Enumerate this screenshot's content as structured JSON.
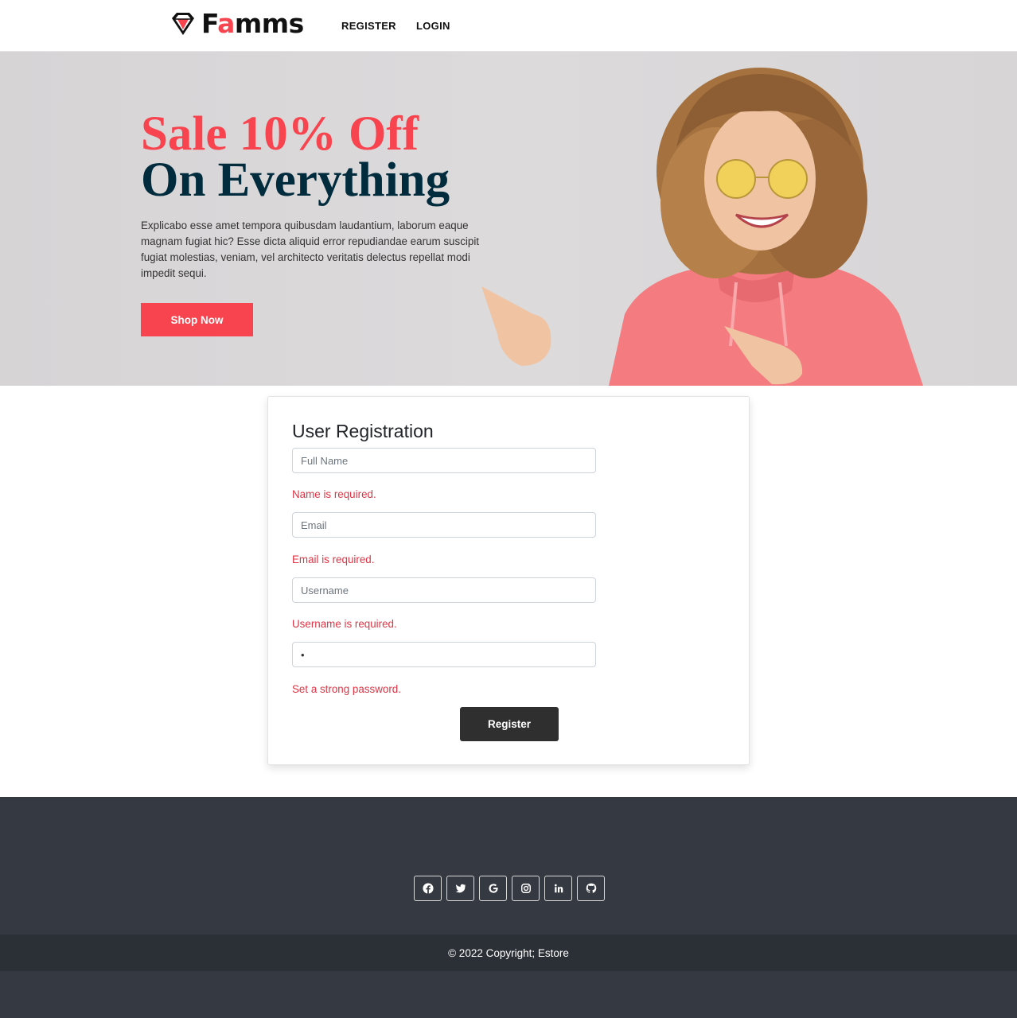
{
  "brand": {
    "name_prefix": "F",
    "name_accent": "a",
    "name_suffix": "mms",
    "accent_color": "#f7444e"
  },
  "nav": {
    "register": "REGISTER",
    "login": "LOGIN"
  },
  "hero": {
    "title_line1": "Sale 10% Off",
    "title_line2": "On Everything",
    "text": "Explicabo esse amet tempora quibusdam laudantium, laborum eaque magnam fugiat hic? Esse dicta aliquid error repudiandae earum suscipit fugiat molestias, veniam, vel architecto veritatis delectus repellat modi impedit sequi.",
    "cta": "Shop Now"
  },
  "form": {
    "title": "User Registration",
    "fields": [
      {
        "placeholder": "Full Name",
        "value": "",
        "error": "Name is required."
      },
      {
        "placeholder": "Email",
        "value": "",
        "error": "Email is required."
      },
      {
        "placeholder": "Username",
        "value": "",
        "error": "Username is required."
      },
      {
        "placeholder": "",
        "value": "•",
        "error": "Set a strong password."
      }
    ],
    "submit": "Register"
  },
  "footer": {
    "social_icons": [
      "facebook-icon",
      "twitter-icon",
      "google-icon",
      "instagram-icon",
      "linkedin-icon",
      "github-icon"
    ],
    "copyright": "© 2022 Copyright; Estore"
  },
  "colors": {
    "primary": "#f7444e",
    "navy": "#002c3e",
    "footer_bg": "#353941",
    "error": "#dc3545",
    "button_dark": "#2f2f2f"
  }
}
